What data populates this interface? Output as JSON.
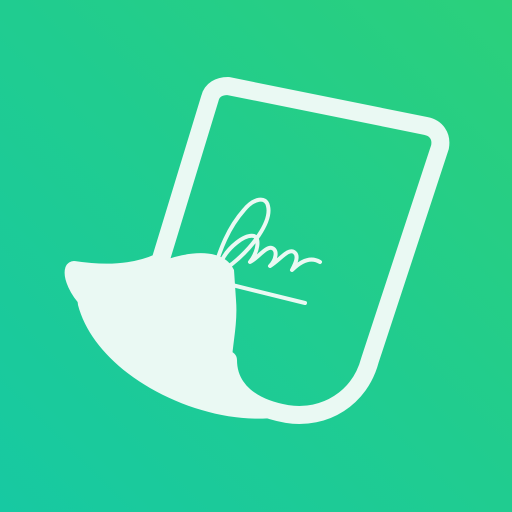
{
  "app_icon": {
    "name": "",
    "colors": {
      "background_start": "#17c9a2",
      "background_end": "#2bd07b",
      "document": "#eaf9f3",
      "signature": "#eaf9f3"
    },
    "icons": [
      "document-icon",
      "signature-icon"
    ]
  }
}
